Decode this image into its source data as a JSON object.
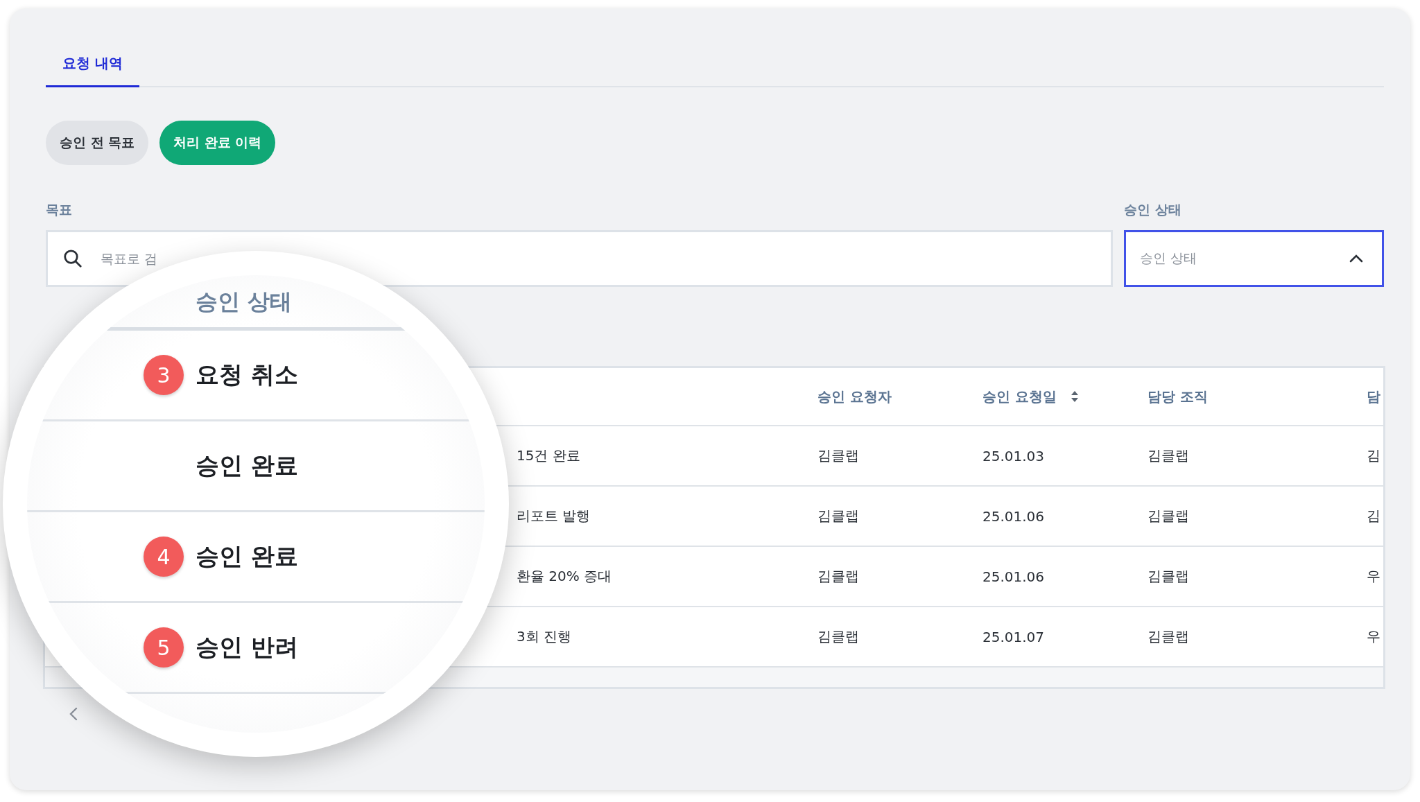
{
  "tabs": [
    {
      "label": "요청 내역",
      "selected": true
    }
  ],
  "filters": [
    {
      "label": "승인 전 목표",
      "selected": false
    },
    {
      "label": "처리 완료 이력",
      "selected": true
    }
  ],
  "search": {
    "label": "목표",
    "placeholder": "목표로 검"
  },
  "status_select": {
    "label": "승인 상태",
    "placeholder": "승인 상태",
    "expanded": true
  },
  "table": {
    "columns": [
      {
        "sortable": false
      },
      {
        "label": "승인 요청자",
        "sortable": false
      },
      {
        "label": "승인 요청일",
        "sortable": true
      },
      {
        "label": "담당 조직",
        "sortable": false
      },
      {
        "label": "담",
        "sortable": false
      }
    ],
    "rows": [
      [
        "15건 완료",
        "김클랩",
        "25.01.03",
        "김클랩",
        "김"
      ],
      [
        "리포트 발행",
        "김클랩",
        "25.01.06",
        "김클랩",
        "김"
      ],
      [
        "환율 20% 증대",
        "김클랩",
        "25.01.06",
        "김클랩",
        "우"
      ],
      [
        "3회 진행",
        "김클랩",
        "25.01.07",
        "김클랩",
        "우"
      ]
    ]
  },
  "magnifier": {
    "title": "승인 상태",
    "options": [
      {
        "label": "요청 취소",
        "badge": "3"
      },
      {
        "label": "승인 완료"
      },
      {
        "label": "승인 완료",
        "badge": "4"
      },
      {
        "label": "승인 반려",
        "badge": "5"
      }
    ]
  }
}
